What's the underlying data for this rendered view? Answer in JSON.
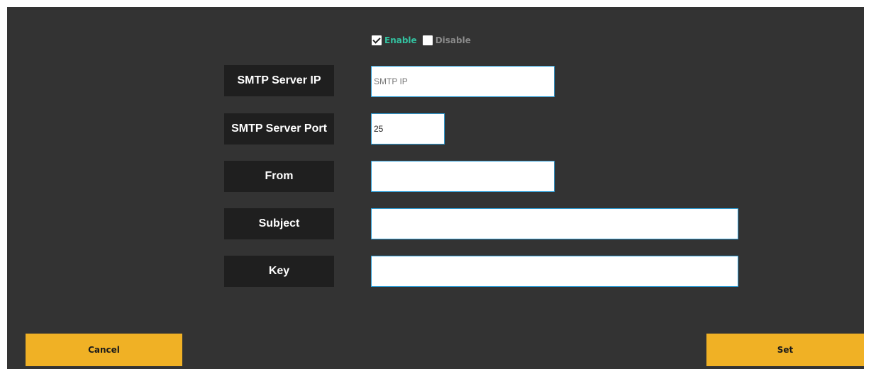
{
  "email_settings": {
    "status_options": {
      "enable_label": "Enable",
      "enable_checked": true,
      "disable_label": "Disable",
      "disable_checked": false
    },
    "fields": {
      "smtp_server_ip": {
        "label": "SMTP Server IP",
        "value": "",
        "placeholder": "SMTP IP"
      },
      "smtp_server_port": {
        "label": "SMTP Server Port",
        "value": "25",
        "placeholder": ""
      },
      "from": {
        "label": "From",
        "value": "",
        "placeholder": ""
      },
      "subject": {
        "label": "Subject",
        "value": "",
        "placeholder": ""
      },
      "key": {
        "label": "Key",
        "value": "",
        "placeholder": ""
      }
    }
  },
  "actions": {
    "cancel_label": "Cancel",
    "set_label": "Set"
  },
  "colors": {
    "panel_background": "#333333",
    "label_background": "#1f1f1f",
    "button_accent": "#f0b125",
    "enable_text": "#33c2a0",
    "disable_text": "#8a8a8a",
    "input_border": "#2f9fd8"
  }
}
